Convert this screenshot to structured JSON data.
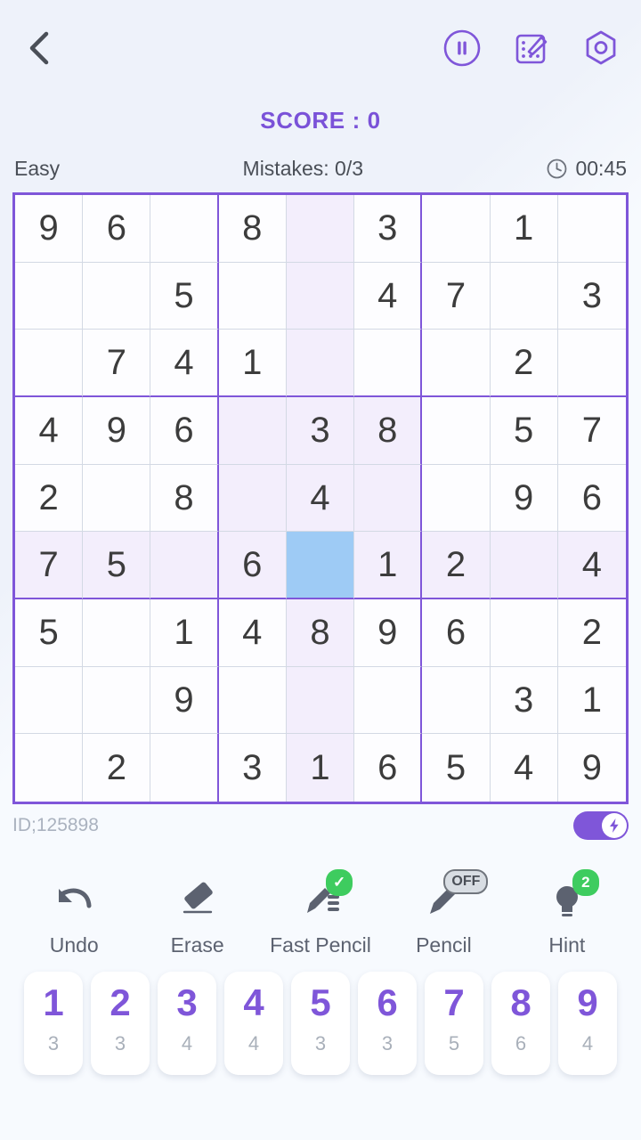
{
  "header": {
    "back_icon": "chevron-left-icon",
    "actions": [
      {
        "name": "pause-button",
        "icon": "pause-icon"
      },
      {
        "name": "theme-button",
        "icon": "paint-board-icon"
      },
      {
        "name": "settings-button",
        "icon": "hexagon-gear-icon"
      }
    ]
  },
  "score": {
    "label": "SCORE : 0",
    "color": "#7a52d8"
  },
  "status": {
    "difficulty": "Easy",
    "mistakes": "Mistakes: 0/3",
    "timer": "00:45",
    "timer_icon": "clock-icon"
  },
  "board": {
    "accent_color": "#7f56d9",
    "peer_highlight_color": "#f3eefc",
    "selected_color": "#9ecbf5",
    "selected_cell": {
      "row": 6,
      "col": 5
    },
    "rows": [
      [
        "9",
        "6",
        "",
        "8",
        "",
        "3",
        "",
        "1",
        ""
      ],
      [
        "",
        "",
        "5",
        "",
        "",
        "4",
        "7",
        "",
        "3"
      ],
      [
        "",
        "7",
        "4",
        "1",
        "",
        "",
        "",
        "2",
        ""
      ],
      [
        "4",
        "9",
        "6",
        "",
        "3",
        "8",
        "",
        "5",
        "7"
      ],
      [
        "2",
        "",
        "8",
        "",
        "4",
        "",
        "",
        "9",
        "6"
      ],
      [
        "7",
        "5",
        "",
        "6",
        "",
        "1",
        "2",
        "",
        "4"
      ],
      [
        "5",
        "",
        "1",
        "4",
        "8",
        "9",
        "6",
        "",
        "2"
      ],
      [
        "",
        "",
        "9",
        "",
        "",
        "",
        "",
        "3",
        "1"
      ],
      [
        "",
        "2",
        "",
        "3",
        "1",
        "6",
        "5",
        "4",
        "9"
      ]
    ]
  },
  "puzzle_info": {
    "id_text": "ID;125898",
    "boost_toggle": {
      "name": "boost-toggle",
      "state": "on",
      "icon": "lightning-bolt-icon",
      "color": "#7f56d9"
    }
  },
  "tools": [
    {
      "label": "Undo",
      "icon": "undo-arrow-icon",
      "badge": null,
      "badge_type": null
    },
    {
      "label": "Erase",
      "icon": "eraser-icon",
      "badge": null,
      "badge_type": null
    },
    {
      "label": "Fast Pencil",
      "icon": "fast-pencil-icon",
      "badge": "✓",
      "badge_type": "green"
    },
    {
      "label": "Pencil",
      "icon": "pencil-icon",
      "badge": "OFF",
      "badge_type": "off"
    },
    {
      "label": "Hint",
      "icon": "lightbulb-icon",
      "badge": "2",
      "badge_type": "round"
    }
  ],
  "numpad": {
    "keys": [
      {
        "value": "1",
        "count": "3"
      },
      {
        "value": "2",
        "count": "3"
      },
      {
        "value": "3",
        "count": "4"
      },
      {
        "value": "4",
        "count": "4"
      },
      {
        "value": "5",
        "count": "3"
      },
      {
        "value": "6",
        "count": "3"
      },
      {
        "value": "7",
        "count": "5"
      },
      {
        "value": "8",
        "count": "6"
      },
      {
        "value": "9",
        "count": "4"
      }
    ],
    "value_color": "#7f56d9",
    "count_color": "#a9b0ba"
  }
}
